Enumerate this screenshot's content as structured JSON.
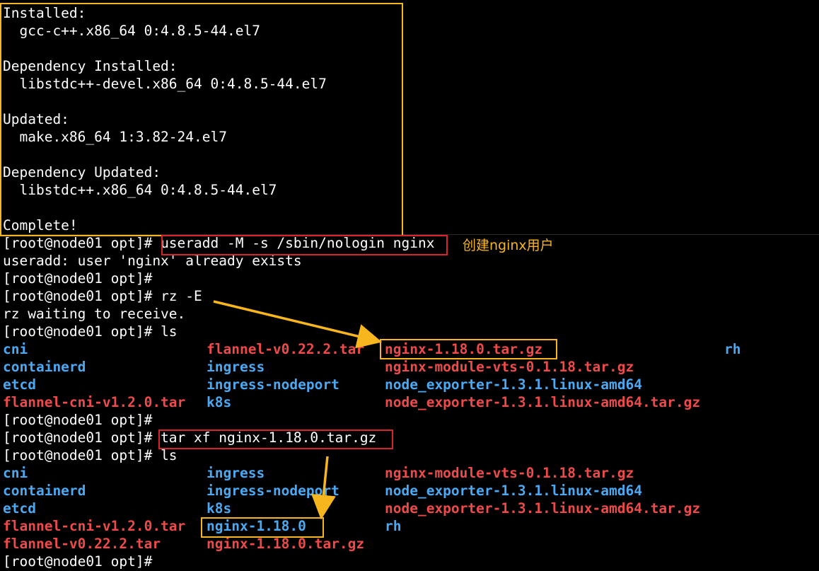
{
  "colors": {
    "background": "#000000",
    "text": "#ffffff",
    "directory": "#4aa9f2",
    "archive": "#ef4a4a",
    "highlight_box": "#f7b51e",
    "command_box": "#d8232a",
    "annotation": "#f7b51e",
    "arrow": "#f7b51e"
  },
  "terminal": {
    "lines": [
      {
        "kind": "output",
        "segments": [
          {
            "text": "Installed:",
            "color": "white"
          }
        ]
      },
      {
        "kind": "output",
        "segments": [
          {
            "text": "  gcc-c++.x86_64 0:4.8.5-44.el7",
            "color": "white"
          }
        ]
      },
      {
        "kind": "blank",
        "segments": []
      },
      {
        "kind": "output",
        "segments": [
          {
            "text": "Dependency Installed:",
            "color": "white"
          }
        ]
      },
      {
        "kind": "output",
        "segments": [
          {
            "text": "  libstdc++-devel.x86_64 0:4.8.5-44.el7",
            "color": "white"
          }
        ]
      },
      {
        "kind": "blank",
        "segments": []
      },
      {
        "kind": "output",
        "segments": [
          {
            "text": "Updated:",
            "color": "white"
          }
        ]
      },
      {
        "kind": "output",
        "segments": [
          {
            "text": "  make.x86_64 1:3.82-24.el7",
            "color": "white"
          }
        ]
      },
      {
        "kind": "blank",
        "segments": []
      },
      {
        "kind": "output",
        "segments": [
          {
            "text": "Dependency Updated:",
            "color": "white"
          }
        ]
      },
      {
        "kind": "output",
        "segments": [
          {
            "text": "  libstdc++.x86_64 0:4.8.5-44.el7",
            "color": "white"
          }
        ]
      },
      {
        "kind": "blank",
        "segments": []
      },
      {
        "kind": "output",
        "segments": [
          {
            "text": "Complete!",
            "color": "white"
          }
        ]
      },
      {
        "kind": "prompt",
        "segments": [
          {
            "text": "[root@node01 opt]# ",
            "color": "white"
          },
          {
            "text": "useradd -M -s /sbin/nologin nginx",
            "color": "white"
          }
        ]
      },
      {
        "kind": "output",
        "segments": [
          {
            "text": "useradd: user 'nginx' already exists",
            "color": "white"
          }
        ]
      },
      {
        "kind": "prompt",
        "segments": [
          {
            "text": "[root@node01 opt]# ",
            "color": "white"
          }
        ]
      },
      {
        "kind": "prompt",
        "segments": [
          {
            "text": "[root@node01 opt]# ",
            "color": "white"
          },
          {
            "text": "rz -E",
            "color": "white"
          }
        ]
      },
      {
        "kind": "output",
        "segments": [
          {
            "text": "rz waiting to receive.",
            "color": "white"
          }
        ]
      },
      {
        "kind": "prompt",
        "segments": [
          {
            "text": "[root@node01 opt]# ",
            "color": "white"
          },
          {
            "text": "ls",
            "color": "white"
          }
        ]
      },
      {
        "kind": "listing",
        "segments": [
          {
            "text": "cni",
            "color": "dir"
          },
          {
            "text": "flannel-v0.22.2.tar",
            "color": "archive"
          },
          {
            "text": "nginx-1.18.0.tar.gz",
            "color": "archive"
          },
          {
            "text": "rh",
            "color": "dir"
          }
        ]
      },
      {
        "kind": "listing",
        "segments": [
          {
            "text": "containerd",
            "color": "dir"
          },
          {
            "text": "ingress",
            "color": "dir"
          },
          {
            "text": "nginx-module-vts-0.1.18.tar.gz",
            "color": "archive"
          }
        ]
      },
      {
        "kind": "listing",
        "segments": [
          {
            "text": "etcd",
            "color": "dir"
          },
          {
            "text": "ingress-nodeport",
            "color": "dir"
          },
          {
            "text": "node_exporter-1.3.1.linux-amd64",
            "color": "dir"
          }
        ]
      },
      {
        "kind": "listing",
        "segments": [
          {
            "text": "flannel-cni-v1.2.0.tar",
            "color": "archive"
          },
          {
            "text": "k8s",
            "color": "dir"
          },
          {
            "text": "node_exporter-1.3.1.linux-amd64.tar.gz",
            "color": "archive"
          }
        ]
      },
      {
        "kind": "prompt",
        "segments": [
          {
            "text": "[root@node01 opt]# ",
            "color": "white"
          }
        ]
      },
      {
        "kind": "prompt",
        "segments": [
          {
            "text": "[root@node01 opt]# ",
            "color": "white"
          },
          {
            "text": "tar xf nginx-1.18.0.tar.gz",
            "color": "white"
          }
        ]
      },
      {
        "kind": "prompt",
        "segments": [
          {
            "text": "[root@node01 opt]# ",
            "color": "white"
          },
          {
            "text": "ls",
            "color": "white"
          }
        ]
      },
      {
        "kind": "listing",
        "segments": [
          {
            "text": "cni",
            "color": "dir"
          },
          {
            "text": "ingress",
            "color": "dir"
          },
          {
            "text": "nginx-module-vts-0.1.18.tar.gz",
            "color": "archive"
          }
        ]
      },
      {
        "kind": "listing",
        "segments": [
          {
            "text": "containerd",
            "color": "dir"
          },
          {
            "text": "ingress-nodeport",
            "color": "dir"
          },
          {
            "text": "node_exporter-1.3.1.linux-amd64",
            "color": "dir"
          }
        ]
      },
      {
        "kind": "listing",
        "segments": [
          {
            "text": "etcd",
            "color": "dir"
          },
          {
            "text": "k8s",
            "color": "dir"
          },
          {
            "text": "node_exporter-1.3.1.linux-amd64.tar.gz",
            "color": "archive"
          }
        ]
      },
      {
        "kind": "listing",
        "segments": [
          {
            "text": "flannel-cni-v1.2.0.tar",
            "color": "archive"
          },
          {
            "text": "nginx-1.18.0",
            "color": "dir"
          },
          {
            "text": "rh",
            "color": "dir"
          }
        ]
      },
      {
        "kind": "listing",
        "segments": [
          {
            "text": "flannel-v0.22.2.tar",
            "color": "archive"
          },
          {
            "text": "nginx-1.18.0.tar.gz",
            "color": "archive"
          }
        ]
      },
      {
        "kind": "prompt",
        "segments": [
          {
            "text": "[root@node01 opt]# ",
            "color": "white"
          }
        ]
      }
    ]
  },
  "annotations": {
    "create_user_note": "创建nginx用户"
  }
}
